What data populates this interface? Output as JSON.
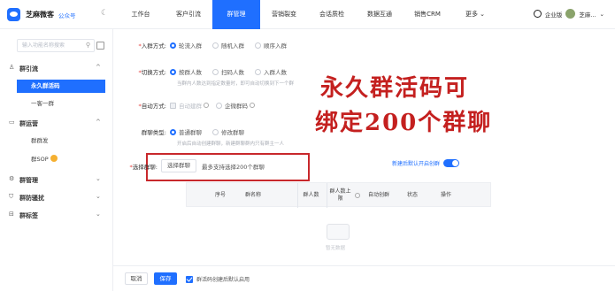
{
  "header": {
    "brand": "芝麻微客",
    "brand_sub": "公众号",
    "nav": [
      {
        "label": "工作台"
      },
      {
        "label": "客户引流"
      },
      {
        "label": "群管理",
        "active": true
      },
      {
        "label": "营销裂变"
      },
      {
        "label": "会话质检"
      },
      {
        "label": "数据互通"
      },
      {
        "label": "销售CRM"
      },
      {
        "label": "更多 ⌄"
      }
    ],
    "user_text": "芝麻...",
    "status_text": "企业版"
  },
  "sidebar": {
    "search_placeholder": "输入功能名称搜索",
    "groups": [
      {
        "label": "群引流",
        "icon": "people-icon",
        "arrow": "^"
      },
      {
        "label": "群运营",
        "icon": "chat-icon",
        "arrow": "^"
      },
      {
        "label": "群管理",
        "icon": "gear-icon",
        "arrow": "⌄"
      },
      {
        "label": "群防骚扰",
        "icon": "shield-icon",
        "arrow": "⌄"
      },
      {
        "label": "群标签",
        "icon": "tag-icon",
        "arrow": "⌄"
      }
    ],
    "items": [
      {
        "label": "永久群活码",
        "active": true
      },
      {
        "label": "一客一群"
      },
      {
        "label": "群群发"
      },
      {
        "label": "群SOP"
      }
    ]
  },
  "form": {
    "join_mode": {
      "label": "入群方式:",
      "options": [
        "轮流入群",
        "随机入群",
        "顺序入群"
      ],
      "selected": 0
    },
    "switch_mode": {
      "label": "切换方式:",
      "options": [
        "按群人数",
        "扫码人数",
        "入群人数"
      ],
      "selected": 0,
      "hint": "当群内人数达到指定数量时，即可自动切换到下一个群"
    },
    "auto_mode": {
      "label": "自动方式:",
      "options": [
        "自动建群",
        "企微群码"
      ]
    },
    "group_type": {
      "label": "群聊类型:",
      "options": [
        "普通群聊",
        "修改群聊"
      ],
      "selected": 0,
      "hint": "开启后自动创建群聊，新建群聊群内只有群主一人"
    },
    "select_group": {
      "label": "选择群聊:",
      "button": "选择群聊",
      "hint": "最多支持选择200个群聊"
    },
    "toggle_label": "新建后默认开启创群"
  },
  "table": {
    "columns": [
      "序号",
      "群名称",
      "群人数",
      "群人数上限",
      "自动创群",
      "状态",
      "操作"
    ],
    "empty_text": "暂无数据"
  },
  "footer": {
    "cancel": "取消",
    "save": "保存",
    "checkbox_label": "群活码创建后默认启用"
  },
  "overlay": {
    "line1": "永久群活码可",
    "line2": "绑定200个群聊"
  },
  "colors": {
    "accent": "#1f6fff",
    "annotation": "#c4201f"
  }
}
